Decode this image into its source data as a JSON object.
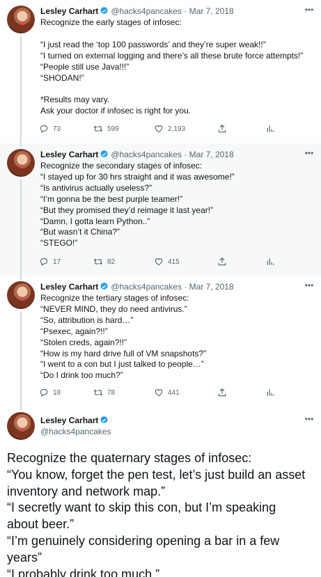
{
  "colors": {
    "text": "#0f1419",
    "muted": "#536471",
    "verified": "#1d9bf0",
    "highlight": "#f7f9f9",
    "thread": "#cfd9de"
  },
  "icons": {
    "reply": "reply-icon",
    "retweet": "retweet-icon",
    "like": "heart-icon",
    "share": "share-icon",
    "analytics": "analytics-icon",
    "more": "more-icon",
    "verified": "verified-badge-icon"
  },
  "tweets": [
    {
      "name": "Lesley Carhart",
      "meta": "@hacks4pancakes · Mar 7, 2018",
      "lines": [
        "Recognize the early stages of infosec:",
        "",
        "“I just read the ‘top 100 passwords’ and they’re super weak!!”",
        "“I turned on external logging and there’s all these brute force attempts!”",
        "“People still use Java!!!”",
        "“SHODAN!”",
        "",
        "*Results may vary.",
        "Ask your doctor if infosec is right for you."
      ],
      "replies": "73",
      "retweets": "599",
      "likes": "2,193"
    },
    {
      "name": "Lesley Carhart",
      "meta": "@hacks4pancakes · Mar 7, 2018",
      "lines": [
        "Recognize the secondary stages of infosec:",
        "“I stayed up for 30 hrs straight and it was awesome!”",
        "“Is antivirus actually useless?”",
        "“I’m gonna be the best purple teamer!”",
        "“But they promised they’d reimage it last year!”",
        "“Damn, I gotta learn Python..”",
        "“But wasn’t it China?”",
        "“STEGO!”"
      ],
      "replies": "17",
      "retweets": "82",
      "likes": "415"
    },
    {
      "name": "Lesley Carhart",
      "meta": "@hacks4pancakes · Mar 7, 2018",
      "lines": [
        "Recognize the tertiary stages of infosec:",
        "“NEVER MIND, they do need antivirus.”",
        "“So, attribution is hard…”",
        "“Psexec, again?!!”",
        "“Stolen creds, again?!!”",
        "“How is my hard drive full of VM snapshots?”",
        "“I went to a con but I just talked to people…”",
        "“Do I drink too much?”"
      ],
      "replies": "18",
      "retweets": "78",
      "likes": "441"
    }
  ],
  "main_tweet": {
    "name": "Lesley Carhart",
    "handle": "@hacks4pancakes",
    "lines": [
      "Recognize the quaternary stages of infosec:",
      "“You know, forget the pen test, let’s just build an asset",
      "inventory and network map.”",
      "“I secretly want to skip this con, but I’m speaking",
      "about beer.”",
      "“I’m genuinely considering opening a bar in a few",
      "years”",
      "“I probably drink too much.”"
    ]
  }
}
